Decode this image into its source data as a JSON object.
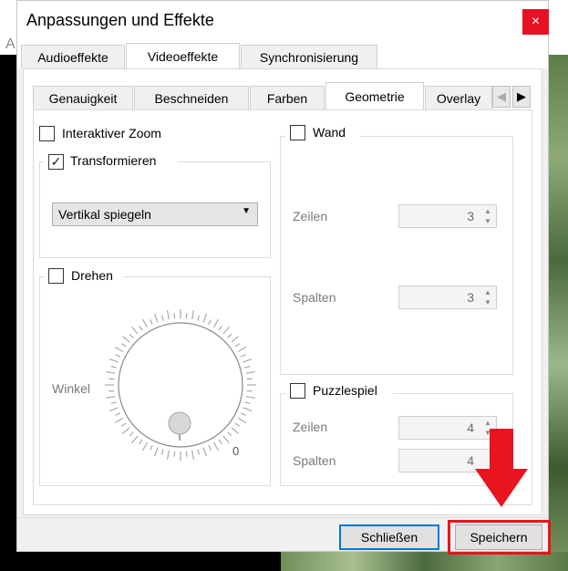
{
  "background_letter": "A",
  "dialog": {
    "title": "Anpassungen und Effekte",
    "close_glyph": "×"
  },
  "main_tabs": [
    {
      "label": "Audioeffekte",
      "active": false
    },
    {
      "label": "Videoeffekte",
      "active": true
    },
    {
      "label": "Synchronisierung",
      "active": false
    }
  ],
  "sub_tabs": [
    {
      "label": "Genauigkeit",
      "active": false
    },
    {
      "label": "Beschneiden",
      "active": false
    },
    {
      "label": "Farben",
      "active": false
    },
    {
      "label": "Geometrie",
      "active": true
    },
    {
      "label": "Overlay",
      "active": false
    }
  ],
  "scroll": {
    "left": "◀",
    "right": "▶"
  },
  "geometry": {
    "interactive_zoom": {
      "label": "Interaktiver Zoom",
      "checked": false
    },
    "transform": {
      "label": "Transformieren",
      "checked": true,
      "check_glyph": "✓",
      "select_value": "Vertikal spiegeln",
      "select_arrow": "▼"
    },
    "rotate": {
      "label": "Drehen",
      "checked": false,
      "angle_label": "Winkel",
      "dial_value": "0"
    },
    "wall": {
      "label": "Wand",
      "checked": false,
      "rows_label": "Zeilen",
      "rows_value": "3",
      "cols_label": "Spalten",
      "cols_value": "3"
    },
    "puzzle": {
      "label": "Puzzlespiel",
      "checked": false,
      "rows_label": "Zeilen",
      "rows_value": "4",
      "cols_label": "Spalten",
      "cols_value": "4"
    }
  },
  "spin_arrows": "▲\n▼",
  "footer": {
    "close_label": "Schließen",
    "save_label": "Speichern"
  },
  "colors": {
    "highlight": "#e8141e",
    "accent": "#0078d7",
    "close_button": "#e81123"
  },
  "annotation_icons": [
    "red-down-arrow-icon"
  ]
}
